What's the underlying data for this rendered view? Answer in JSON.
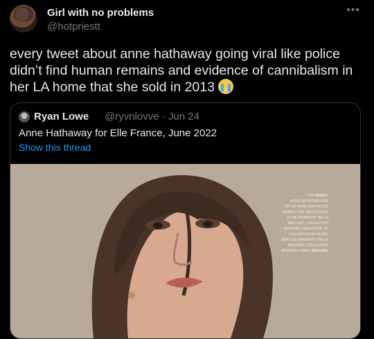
{
  "tweet": {
    "author_name": "Girl with no problems",
    "author_handle": "@hotpriestt",
    "more_icon": "more-horizontal-icon",
    "text": "every tweet about anne hathaway going viral like police didn’t find human remains and evidence of cannibalism in her LA home that she sold in 2013",
    "emoji": "loudly-crying-face-emoji"
  },
  "quoted_tweet": {
    "author_name": "Ryan Lowe",
    "author_handle": "@ryvnlovve",
    "separator": "·",
    "date": "Jun 24",
    "text": "Anne Hathaway for Elle France, June 2022",
    "show_thread_label": "Show this thread",
    "photo_caption_lines": [
      [
        "Top ",
        "PRADA."
      ],
      [
        "Boucles d'oreilles",
        ""
      ],
      [
        "en or rose serties de",
        ""
      ],
      [
        "rubellites taille poire",
        ""
      ],
      [
        "et de diamants taille",
        ""
      ],
      [
        "brillant, collection",
        ""
      ],
      [
        "serpenti seduttori. et",
        ""
      ],
      [
        "collier en or blanc",
        ""
      ],
      [
        "serti de diamants taille",
        ""
      ],
      [
        "brillant, collection",
        ""
      ],
      [
        "serpenti viper, ",
        "BULGARI."
      ]
    ]
  },
  "colors": {
    "background": "#000000",
    "primary_text": "#e7e9ea",
    "secondary_text": "#71767b",
    "link": "#1d9bf0",
    "border": "#2f3336"
  }
}
